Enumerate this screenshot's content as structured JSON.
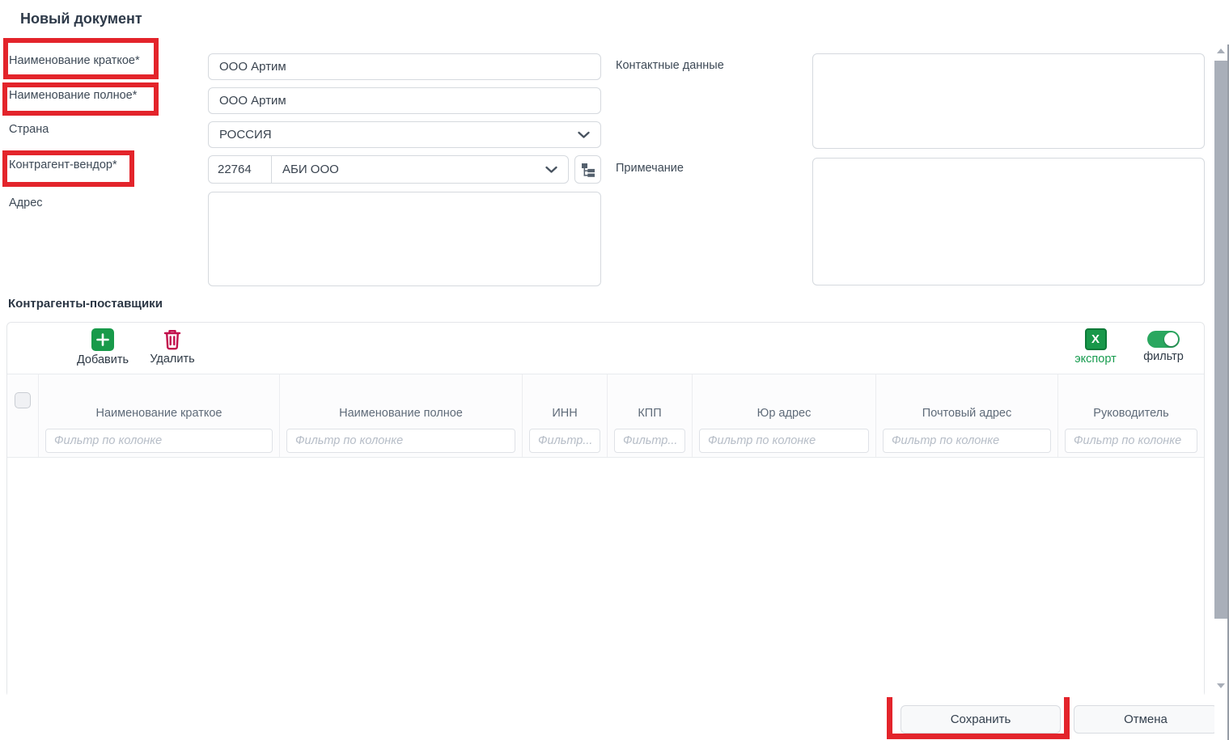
{
  "page": {
    "title": "Новый документ"
  },
  "form": {
    "short_name": {
      "label": "Наименование краткое*",
      "value": "ООО Артим"
    },
    "full_name": {
      "label": "Наименование полное*",
      "value": "ООО Артим"
    },
    "country": {
      "label": "Страна",
      "value": "РОССИЯ"
    },
    "vendor": {
      "label": "Контрагент-вендор*",
      "code": "22764",
      "name": "АБИ ООО"
    },
    "address": {
      "label": "Адрес",
      "value": ""
    },
    "contacts": {
      "label": "Контактные данные",
      "value": ""
    },
    "note": {
      "label": "Примечание",
      "value": ""
    }
  },
  "suppliers": {
    "title": "Контрагенты-поставщики",
    "toolbar": {
      "add": "Добавить",
      "delete": "Удалить",
      "export": "экспорт",
      "filter": "фильтр",
      "add_glyph": "+",
      "excel_glyph": "X",
      "filter_toggle_state": "on"
    },
    "columns": [
      {
        "label": "Наименование краткое",
        "filter": "Фильтр по колонке"
      },
      {
        "label": "Наименование полное",
        "filter": "Фильтр по колонке"
      },
      {
        "label": "ИНН",
        "filter": "Фильтр..."
      },
      {
        "label": "КПП",
        "filter": "Фильтр..."
      },
      {
        "label": "Юр адрес",
        "filter": "Фильтр по колонке"
      },
      {
        "label": "Почтовый адрес",
        "filter": "Фильтр по колонке"
      },
      {
        "label": "Руководитель",
        "filter": "Фильтр по колонке"
      }
    ],
    "rows": []
  },
  "footer": {
    "save": "Сохранить",
    "cancel": "Отмена"
  },
  "colors": {
    "annotation_red": "#e3242b",
    "add_green": "#189a4a",
    "export_text_green": "#169b4e",
    "delete_crimson": "#c2104c",
    "toggle_on_green": "#2aa75f"
  }
}
